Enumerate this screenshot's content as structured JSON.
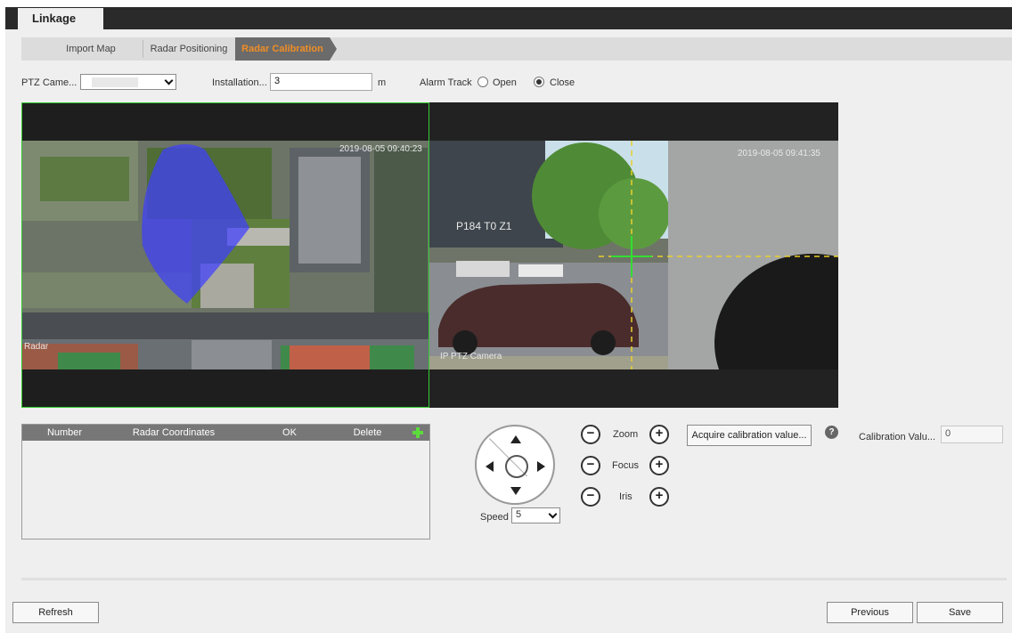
{
  "title": "Linkage",
  "steps": [
    "Import Map",
    "Radar Positioning",
    "Radar Calibration"
  ],
  "active_step": "Radar Calibration",
  "form": {
    "ptz_camera_label": "PTZ Came...",
    "ptz_camera_value": "",
    "installation_label": "Installation...",
    "installation_value": "3",
    "installation_unit": "m",
    "alarm_track_label": "Alarm Track",
    "alarm_track_options": [
      "Open",
      "Close"
    ],
    "alarm_track_selected": "Close"
  },
  "video": {
    "left_timestamp": "2019-08-05 09:40:23",
    "left_caption": "Radar",
    "right_ptz_overlay": "P184 T0 Z1",
    "right_timestamp": "2019-08-05 09:41:35",
    "right_caption": "IP PTZ Camera"
  },
  "table": {
    "columns": [
      "Number",
      "Radar Coordinates",
      "OK",
      "Delete"
    ],
    "add_icon": "plus-icon",
    "rows": []
  },
  "ptz": {
    "speed_label": "Speed",
    "speed_value": "5",
    "zoom_label": "Zoom",
    "focus_label": "Focus",
    "iris_label": "Iris",
    "minus": "−",
    "plus": "+"
  },
  "calibration": {
    "acquire_button": "Acquire calibration value...",
    "help_symbol": "?",
    "value_label": "Calibration Valu...",
    "value": "0"
  },
  "buttons": {
    "refresh": "Refresh",
    "previous": "Previous",
    "save": "Save"
  },
  "colors": {
    "accent": "#f08d25",
    "radar_sector": "#3f3fff",
    "calibration_marker": "#33dd33",
    "guide_line": "#e8d02a"
  }
}
